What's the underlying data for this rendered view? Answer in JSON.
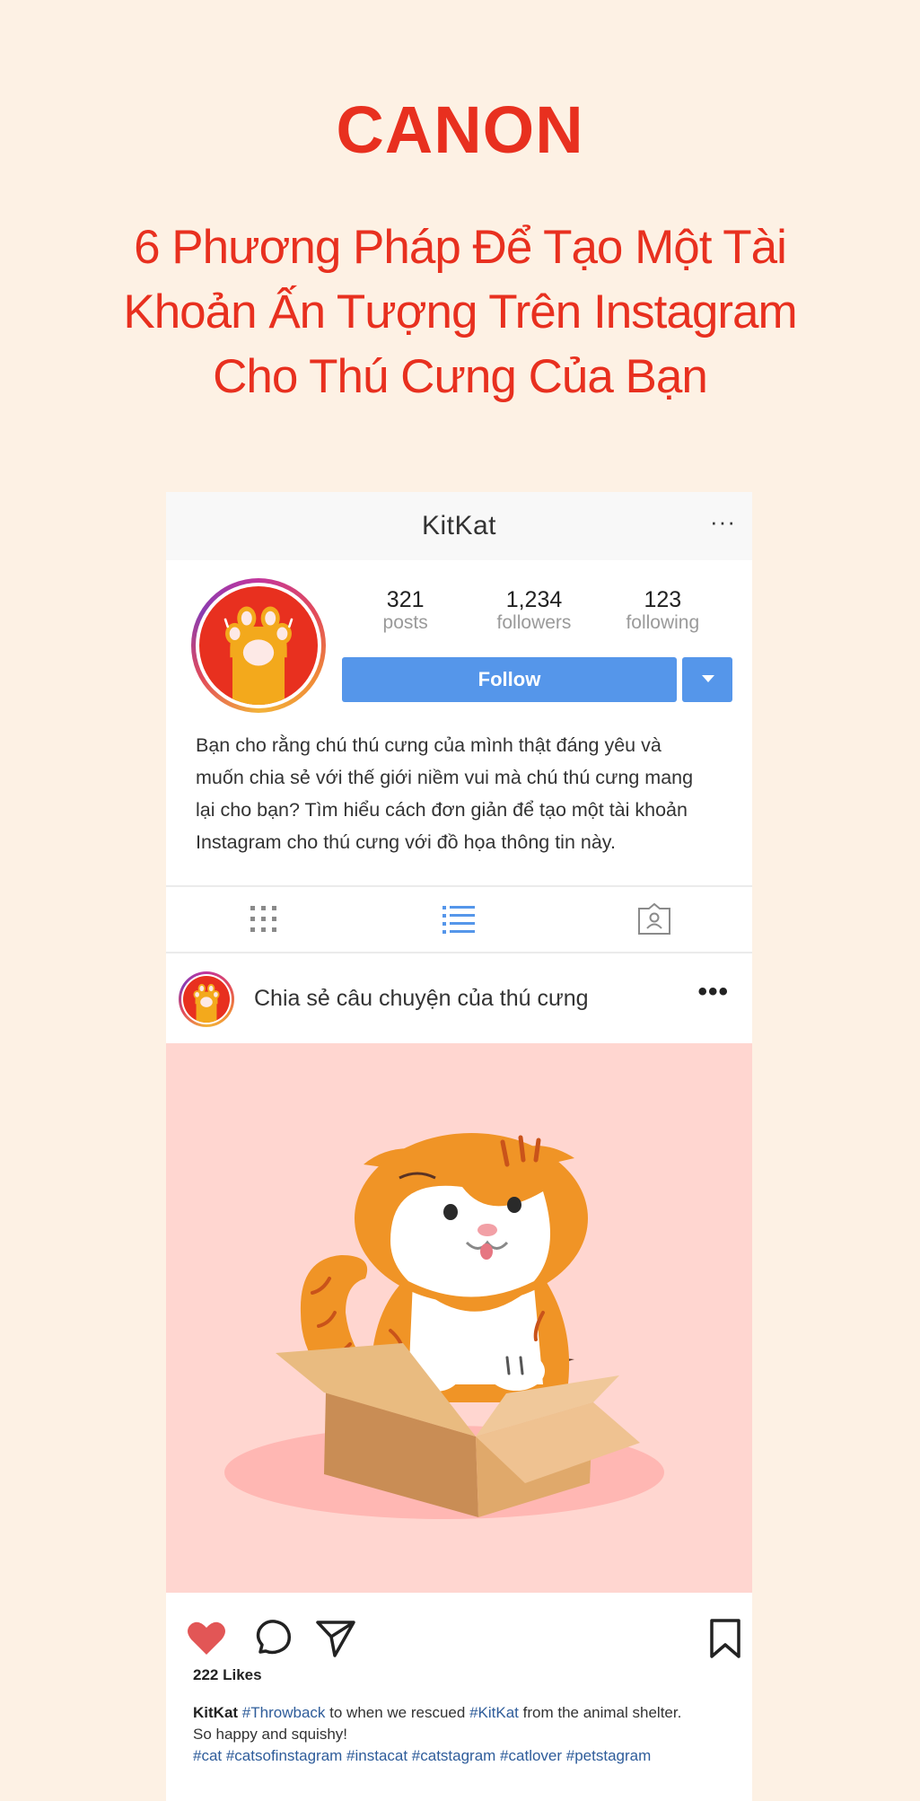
{
  "brand": "CANON",
  "headline": {
    "line1": "6 Phương Pháp Để Tạo Một Tài",
    "line2": "Khoản Ấn Tượng Trên Instagram",
    "line3": "Cho Thú Cưng Của Bạn"
  },
  "profile": {
    "username": "KitKat",
    "more_label": "···",
    "stats": [
      {
        "value": "321",
        "label": "posts"
      },
      {
        "value": "1,234",
        "label": "followers"
      },
      {
        "value": "123",
        "label": "following"
      }
    ],
    "follow_label": "Follow",
    "bio": {
      "line1": "Bạn cho rằng chú thú cưng của mình thật đáng yêu và",
      "line2": "muốn chia sẻ với thế giới niềm vui mà chú thú cưng mang",
      "line3": "lại cho bạn? Tìm hiểu cách đơn giản để tạo một tài khoản",
      "line4": "Instagram cho thú cưng với đồ họa thông tin này."
    }
  },
  "tabs": [
    {
      "icon": "grid-icon"
    },
    {
      "icon": "list-icon",
      "active": true
    },
    {
      "icon": "tagged-icon"
    }
  ],
  "post": {
    "title": "Chia sẻ câu chuyện của thú cưng",
    "more_label": "•••",
    "likes": "222 Likes",
    "caption": {
      "user": "KitKat",
      "tag1": "#Throwback",
      "text1": "to when we rescued",
      "tag2": "#KitKat",
      "text2": "from the animal shelter.",
      "line2": "So happy and squishy!",
      "hashtags": "#cat #catsofinstagram #instacat #catstagram #catlover #petstagram"
    }
  },
  "colors": {
    "background": "#fdf1e4",
    "brand_red": "#e8301f",
    "follow_blue": "#5596ea",
    "post_bg": "#ffd6d0",
    "heart": "#e25656",
    "hashtag": "#2e5c9a"
  }
}
